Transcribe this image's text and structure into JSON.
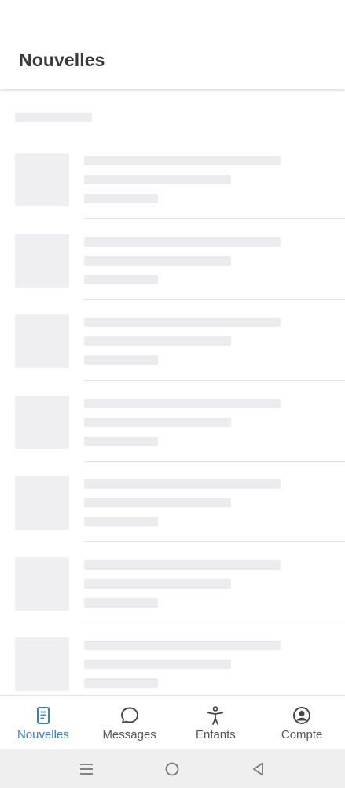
{
  "header": {
    "title": "Nouvelles"
  },
  "loading_rows": 7,
  "bottom_nav": {
    "active_color": "#3b7fc4",
    "items": [
      {
        "label": "Nouvelles",
        "icon": "newspaper-icon",
        "active": true
      },
      {
        "label": "Messages",
        "icon": "chat-bubble-icon",
        "active": false
      },
      {
        "label": "Enfants",
        "icon": "accessibility-person-icon",
        "active": false
      },
      {
        "label": "Compte",
        "icon": "account-circle-icon",
        "active": false
      }
    ]
  },
  "system_bar": {
    "buttons": [
      "recent-apps-icon",
      "home-icon",
      "back-icon"
    ]
  }
}
